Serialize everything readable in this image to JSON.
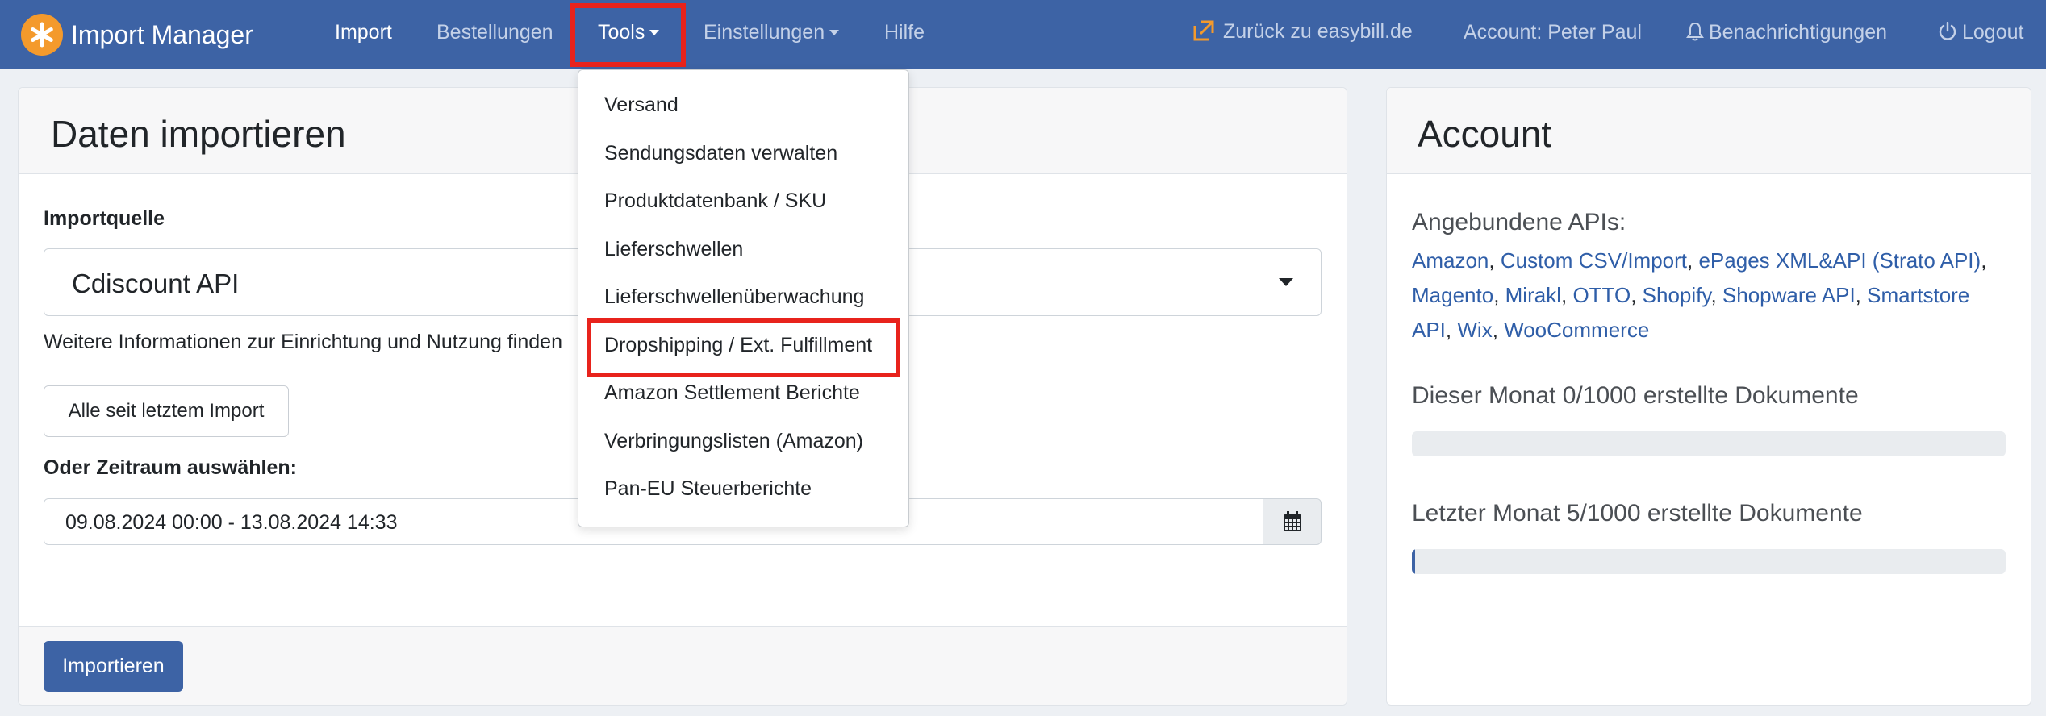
{
  "navbar": {
    "brand": "Import Manager",
    "items": [
      {
        "label": "Import",
        "active": true
      },
      {
        "label": "Bestellungen"
      },
      {
        "label": "Tools",
        "dropdown": true
      },
      {
        "label": "Einstellungen",
        "dropdown": true
      },
      {
        "label": "Hilfe"
      }
    ],
    "right": {
      "back_label": "Zurück zu easybill.de",
      "account_label": "Account: Peter Paul",
      "notifications_label": "Benachrichtigungen",
      "logout_label": "Logout"
    }
  },
  "tools_menu": {
    "items": [
      "Versand",
      "Sendungsdaten verwalten",
      "Produktdatenbank / SKU",
      "Lieferschwellen",
      "Lieferschwellenüberwachung",
      "Dropshipping / Ext. Fulfillment",
      "Amazon Settlement Berichte",
      "Verbringungslisten (Amazon)",
      "Pan-EU Steuerberichte"
    ],
    "highlighted_index": 5
  },
  "import_card": {
    "title": "Daten importieren",
    "source_label": "Importquelle",
    "source_value": "Cdiscount API",
    "help_text": "Weitere Informationen zur Einrichtung und Nutzung finden",
    "since_last_button": "Alle seit letztem Import",
    "period_label": "Oder Zeitraum auswählen:",
    "period_value": "09.08.2024 00:00 - 13.08.2024 14:33",
    "submit_button": "Importieren"
  },
  "account_card": {
    "title": "Account",
    "apis_label": "Angebundene APIs:",
    "apis": [
      "Amazon",
      "Custom CSV/Import",
      "ePages XML&API (Strato API)",
      "Magento",
      "Mirakl",
      "OTTO",
      "Shopify",
      "Shopware API",
      "Smartstore API",
      "Wix",
      "WooCommerce"
    ],
    "this_month": "Dieser Monat 0/1000 erstellte Dokumente",
    "this_month_progress": 0.0,
    "last_month": "Letzter Monat 5/1000 erstellte Dokumente",
    "last_month_progress": 0.005
  },
  "colors": {
    "navbar": "#3d63a5",
    "brand_logo": "#f49a2c",
    "highlight_box": "#e8231c",
    "link": "#2f5ea8"
  }
}
